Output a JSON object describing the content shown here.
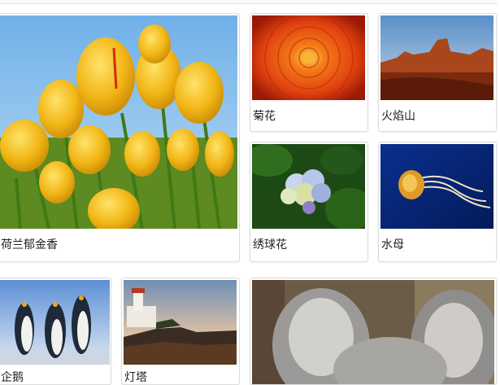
{
  "gallery": {
    "items": [
      {
        "caption": "荷兰郁金香",
        "image": "tulips-photo"
      },
      {
        "caption": "菊花",
        "image": "chrysanthemum-photo"
      },
      {
        "caption": "火焰山",
        "image": "desert-photo"
      },
      {
        "caption": "绣球花",
        "image": "hydrangeas-photo"
      },
      {
        "caption": "水母",
        "image": "jellyfish-photo"
      },
      {
        "caption": "企鹅",
        "image": "penguins-photo"
      },
      {
        "caption": "灯塔",
        "image": "lighthouse-photo"
      },
      {
        "caption": "",
        "image": "koala-photo"
      }
    ]
  }
}
